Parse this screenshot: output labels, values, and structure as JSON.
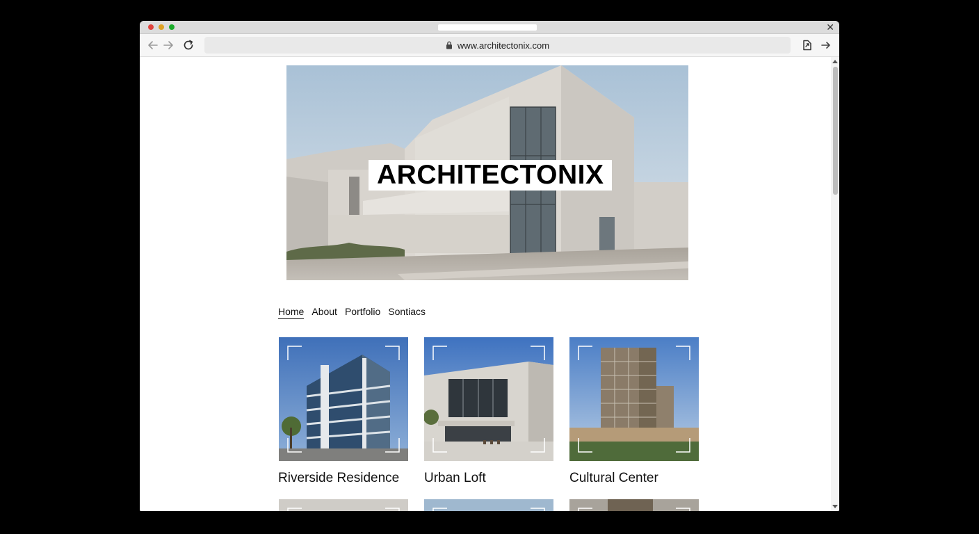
{
  "browser": {
    "url": "www.architectonix.com",
    "icons": [
      "back-arrow-icon",
      "forward-arrow-icon",
      "reload-icon",
      "lock-icon",
      "share-icon",
      "forward-icon",
      "close-icon"
    ]
  },
  "site": {
    "title": "ARCHITECTONIX",
    "nav": [
      {
        "label": "Home",
        "active": true
      },
      {
        "label": "About",
        "active": false
      },
      {
        "label": "Portfolio",
        "active": false
      },
      {
        "label": "Sontiacs",
        "active": false
      }
    ],
    "projects": [
      {
        "title": "Riverside Residence"
      },
      {
        "title": "Urban Loft"
      },
      {
        "title": "Cultural Center"
      }
    ]
  },
  "colors": {
    "sky": "#b8cddd",
    "concrete": "#d9d6d1",
    "card_sky": "#4d7fc2",
    "black_bg": "#000000"
  }
}
